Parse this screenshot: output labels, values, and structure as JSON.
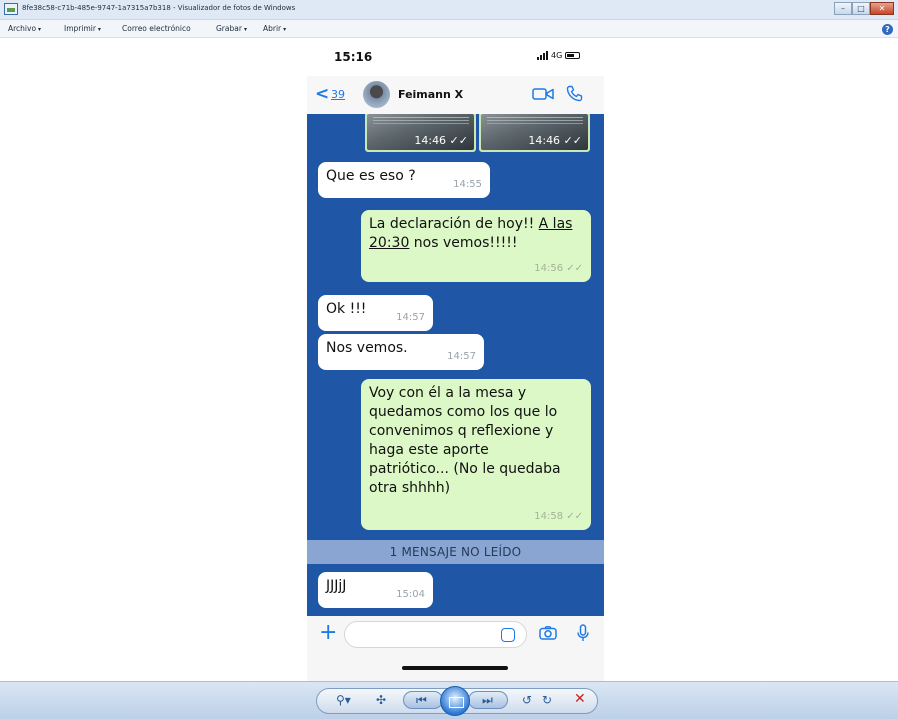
{
  "window": {
    "title": "8fe38c58-c71b-485e-9747-1a7315a7b318 - Visualizador de fotos de Windows",
    "buttons": [
      "–",
      "□",
      "✕"
    ]
  },
  "menu": {
    "items": [
      {
        "label": "Archivo",
        "caret": "▾"
      },
      {
        "label": "Imprimir",
        "caret": "▾"
      },
      {
        "label": "Correo electrónico",
        "caret": ""
      },
      {
        "label": "Grabar",
        "caret": "▾"
      },
      {
        "label": "Abrir",
        "caret": "▾"
      }
    ],
    "help": "?"
  },
  "phone": {
    "status": {
      "time": "15:16",
      "network": "4G"
    },
    "header": {
      "back_arrow": "<",
      "back_count": "39",
      "contact_name": "Feimann X"
    },
    "image_messages": [
      {
        "time": "14:46 ✓✓"
      },
      {
        "time": "14:46 ✓✓"
      }
    ],
    "messages": [
      {
        "direction": "in",
        "text": "Que es eso ?",
        "time": "14:55"
      },
      {
        "direction": "out",
        "text_before": "La declaración de hoy!! ",
        "text_link": "A las 20:30",
        "text_after": " nos vemos!!!!!",
        "time": "14:56 ✓✓"
      },
      {
        "direction": "in",
        "text": "Ok !!!",
        "time": "14:57"
      },
      {
        "direction": "in",
        "text": "Nos vemos.",
        "time": "14:57"
      },
      {
        "direction": "out",
        "text": "Voy con él a la mesa y quedamos como los que lo convenimos q reflexione y haga este aporte patriótico... (No le quedaba otra shhhh)",
        "time": "14:58 ✓✓"
      },
      {
        "direction": "in",
        "text": "JJJjJ",
        "time": "15:04"
      }
    ],
    "unread_banner": "1 MENSAJE NO LEÍDO",
    "input": {
      "plus": "+",
      "placeholder": ""
    }
  },
  "toolbar": {
    "zoom": "⚲▾",
    "fit": "✣",
    "prev": "⏮",
    "next": "⏭",
    "rotate_ccw": "↺",
    "rotate_cw": "↻",
    "delete": "✕"
  },
  "colors": {
    "chat_background": "#1f56a6",
    "incoming_bubble": "#ffffff",
    "outgoing_bubble": "#dcf8c6",
    "unread_banner": "#8ba5d3",
    "accent": "#1f7ae6"
  }
}
